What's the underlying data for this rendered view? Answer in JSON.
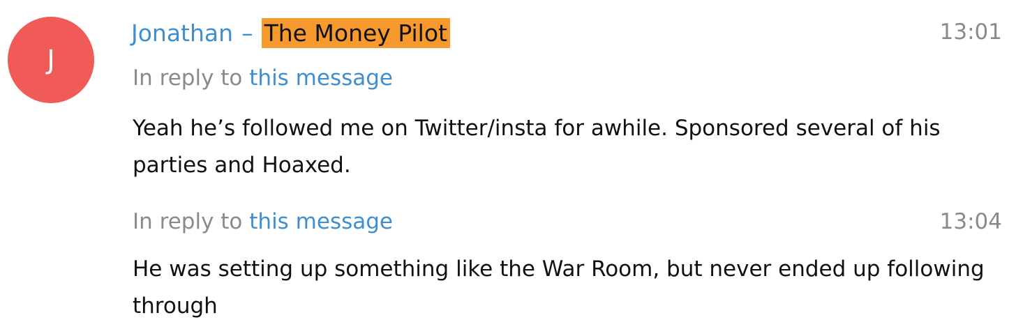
{
  "message": {
    "avatar_letter": "J",
    "avatar_color": "#f05a57",
    "sender_name": "Jonathan",
    "separator": "–",
    "sender_highlight": "The Money Pilot",
    "highlight_color": "#f79a2e",
    "link_color": "#3f8fd0"
  },
  "posts": [
    {
      "time": "13:01",
      "reply_prefix": "In reply to",
      "reply_link": "this message",
      "text": "Yeah he’s followed me on Twitter/insta for awhile. Sponsored several of his parties and Hoaxed."
    },
    {
      "time": "13:04",
      "reply_prefix": "In reply to",
      "reply_link": "this message",
      "text": "He was setting up something like the War Room, but never ended up following through"
    }
  ]
}
